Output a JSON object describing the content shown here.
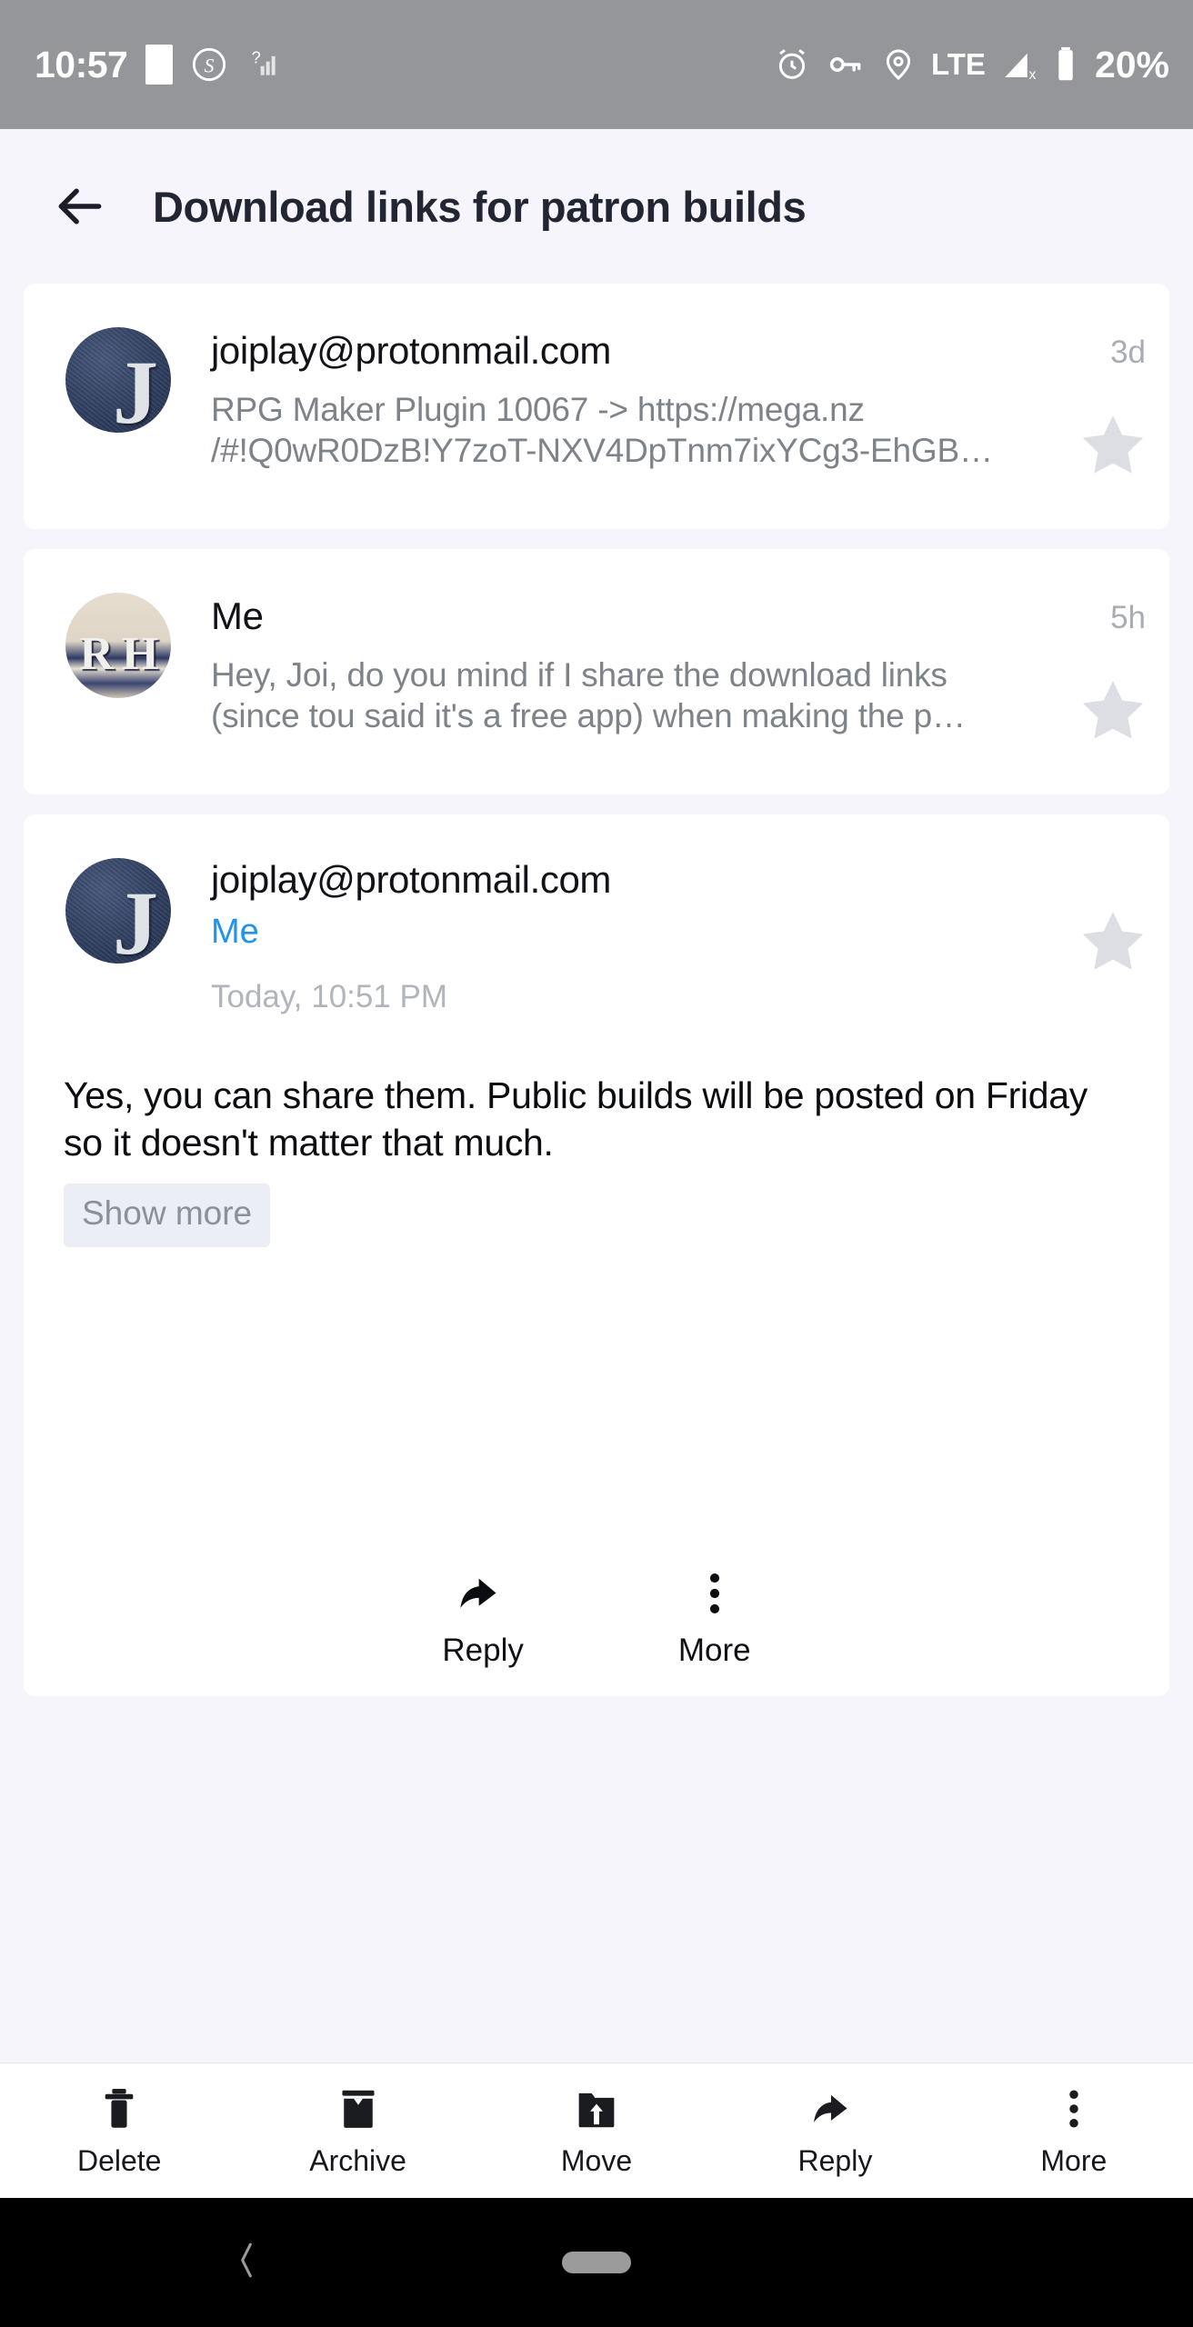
{
  "status_bar": {
    "time": "10:57",
    "battery_percent": "20%",
    "network": "LTE",
    "icons_left": [
      "white-square-icon",
      "s-circle-icon",
      "signal-unknown-icon"
    ],
    "icons_right": [
      "alarm-icon",
      "vpn-key-icon",
      "location-icon",
      "signal-off-icon",
      "battery-icon"
    ]
  },
  "header": {
    "back_icon": "arrow-left-icon",
    "title": "Download links for patron builds"
  },
  "messages": [
    {
      "avatar_type": "J",
      "from": "joiplay@protonmail.com",
      "snippet": "RPG Maker Plugin 10067 -> https://mega.nz /#!Q0wR0DzB!Y7zoT-NXV4DpTnm7ixYCg3-EhGB…",
      "time": "3d",
      "starred": false,
      "expanded": false
    },
    {
      "avatar_type": "RH",
      "from": "Me",
      "snippet": "Hey, Joi, do you mind if I share the download links (since tou said it's a free app) when making the p…",
      "time": "5h",
      "starred": false,
      "expanded": false
    },
    {
      "avatar_type": "J",
      "from": "joiplay@protonmail.com",
      "to": "Me",
      "date": "Today, 10:51 PM",
      "body": "Yes, you can share them. Public builds will be posted on Friday so it doesn't matter that much.",
      "show_more_label": "Show more",
      "starred": false,
      "expanded": true
    }
  ],
  "inline_actions": [
    {
      "label": "Reply",
      "icon": "reply-arrow-icon"
    },
    {
      "label": "More",
      "icon": "overflow-dots-icon"
    }
  ],
  "bottom_bar": [
    {
      "label": "Delete",
      "icon": "trash-icon"
    },
    {
      "label": "Archive",
      "icon": "archive-box-icon"
    },
    {
      "label": "Move",
      "icon": "folder-move-icon"
    },
    {
      "label": "Reply",
      "icon": "reply-arrow-icon"
    },
    {
      "label": "More",
      "icon": "overflow-dots-icon"
    }
  ],
  "nav_bar": {
    "back_icon": "chevron-left-icon",
    "home_pill": "home-pill-indicator"
  },
  "colors": {
    "status_bar_bg": "#949699",
    "page_bg": "#f5f5fb",
    "card_bg": "#ffffff",
    "title_text": "#222532",
    "secondary_text": "#7e8389",
    "accent_blue": "#1f94ef",
    "star_gray": "#dcdee4",
    "nav_bar_bg": "#000000"
  }
}
